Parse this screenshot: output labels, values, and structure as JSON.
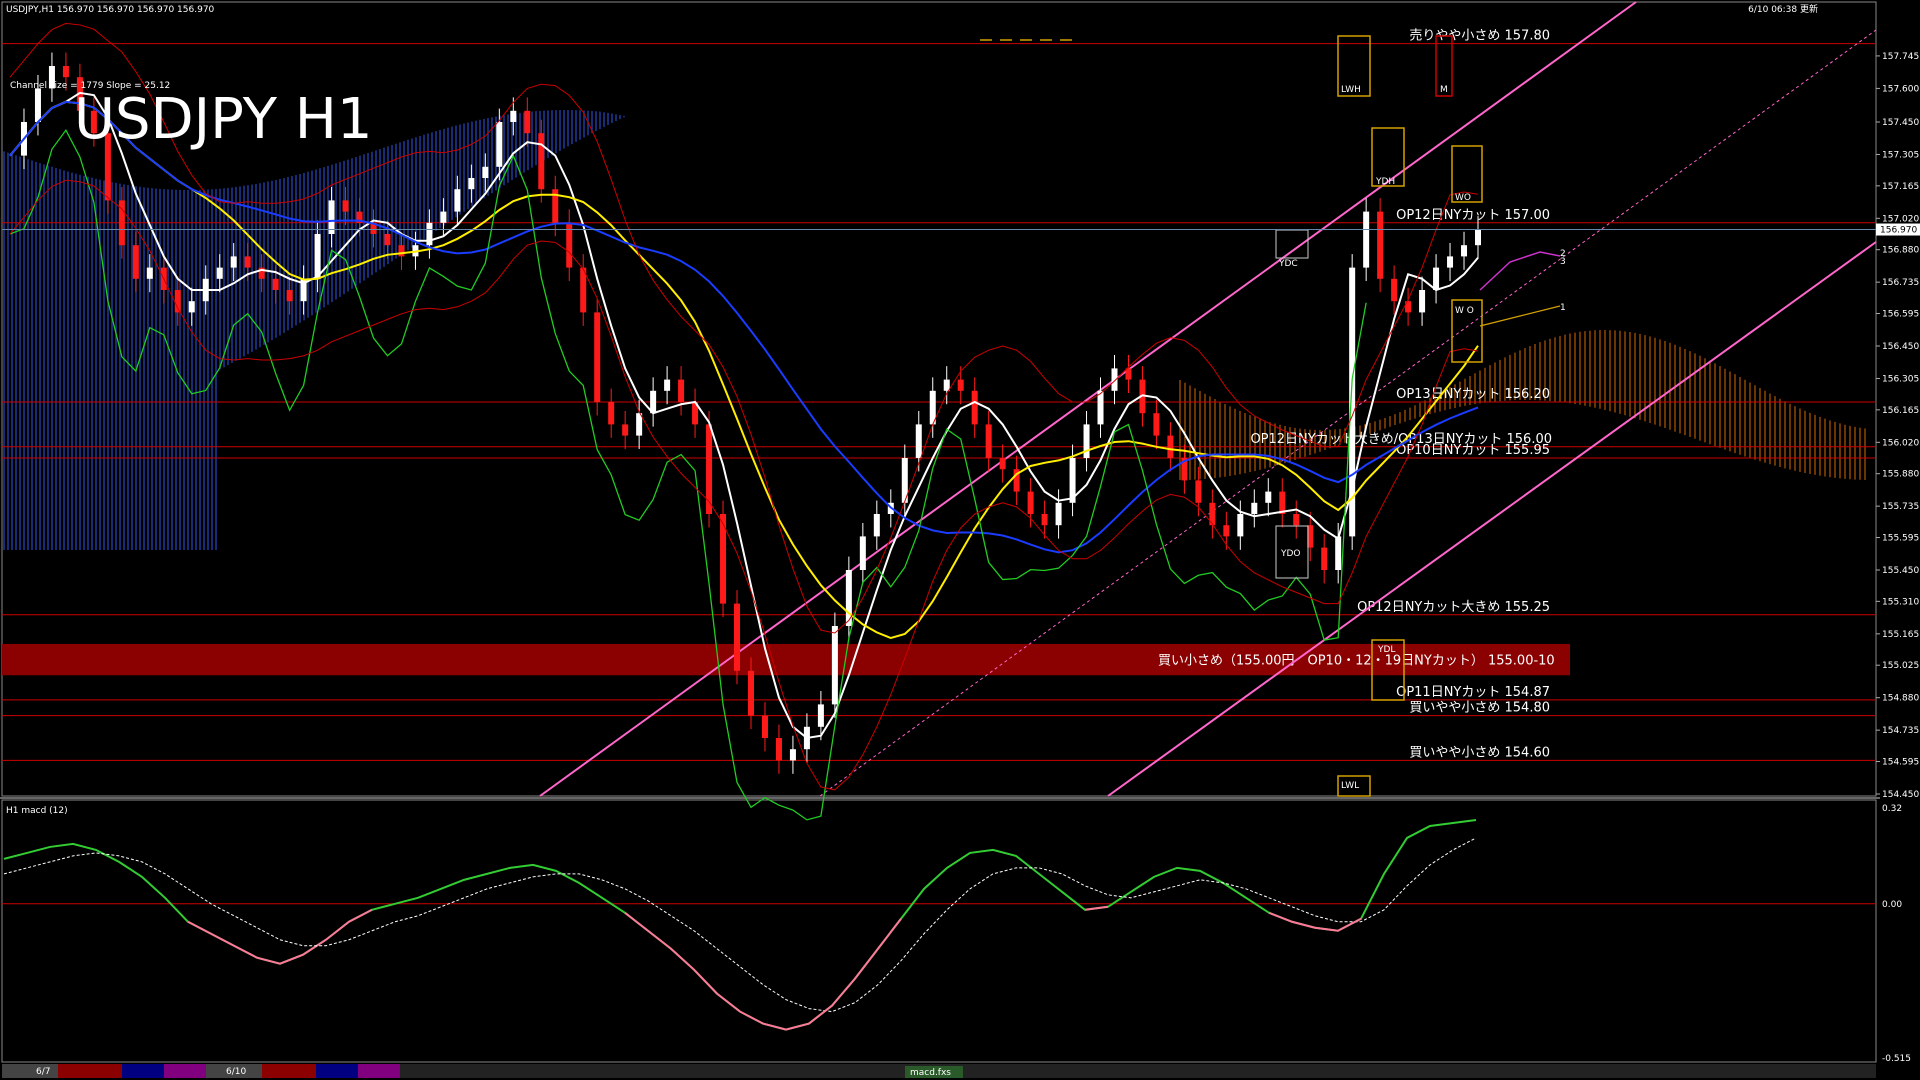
{
  "header": {
    "symbol_line": "USDJPY,H1  156.970 156.970 156.970 156.970",
    "datetime": "6/10 06:38 更新",
    "big_title": "USDJPY H1",
    "channel_info": "Channel size = 1779 Slope = 25.12"
  },
  "macd_panel": {
    "title": "H1  macd (12)"
  },
  "bottom_bar": {
    "label_1": "6/7",
    "label_2": "6/10",
    "label_3": "macd.fxs"
  },
  "colors": {
    "sell": "#cc0000",
    "buy": "#ffffff",
    "level_line": "#cc0000",
    "band": "#8b0000",
    "channel": "#ff66cc",
    "macd_main": "#33cc33",
    "macd_neg": "#ff7799",
    "signal": "#ffffff"
  },
  "chart_data": {
    "type": "line",
    "title": "USDJPY H1",
    "ylim": [
      154.45,
      157.95
    ],
    "price_ticks": [
      "157.745",
      "157.600",
      "157.450",
      "157.305",
      "157.165",
      "157.020",
      "156.880",
      "156.735",
      "156.595",
      "156.450",
      "156.305",
      "156.165",
      "156.020",
      "155.880",
      "155.735",
      "155.595",
      "155.450",
      "155.310",
      "155.165",
      "155.025",
      "154.880",
      "154.735",
      "154.595",
      "154.450"
    ],
    "current_price": "156.970",
    "levels": [
      {
        "price": 157.8,
        "text": "売りやや小さめ 157.80"
      },
      {
        "price": 157.0,
        "text": "OP12日NYカット 157.00"
      },
      {
        "price": 156.2,
        "text": "OP13日NYカット 156.20"
      },
      {
        "price": 156.0,
        "text": "OP12日NYカット大きめ/OP13日NYカット 156.00"
      },
      {
        "price": 155.95,
        "text": "OP10日NYカット 155.95"
      },
      {
        "price": 155.25,
        "text": "OP12日NYカット大きめ 155.25"
      },
      {
        "price": 154.87,
        "text": "OP11日NYカット 154.87"
      },
      {
        "price": 154.8,
        "text": "買いやや小さめ 154.80"
      },
      {
        "price": 154.6,
        "text": "買いやや小さめ 154.60"
      }
    ],
    "buy_band": {
      "price_top": 155.12,
      "price_bottom": 154.98,
      "text": "買い小さめ（155.00円　OP10・12・19日NYカット） 155.00-10"
    },
    "box_labels": [
      "LWH",
      "YDH",
      "YDC",
      "YDO",
      "YDL",
      "LWL",
      "M",
      "W O",
      "WO"
    ],
    "projection_labels": [
      "1",
      "2",
      "3"
    ],
    "close": [
      157.3,
      157.45,
      157.6,
      157.7,
      157.65,
      157.5,
      157.4,
      157.1,
      156.9,
      156.75,
      156.8,
      156.7,
      156.6,
      156.65,
      156.75,
      156.8,
      156.85,
      156.8,
      156.75,
      156.7,
      156.65,
      156.75,
      156.95,
      157.1,
      157.05,
      157.0,
      156.95,
      156.9,
      156.85,
      156.9,
      157.0,
      157.05,
      157.15,
      157.2,
      157.25,
      157.45,
      157.5,
      157.4,
      157.15,
      157.0,
      156.8,
      156.6,
      156.2,
      156.1,
      156.05,
      156.15,
      156.25,
      156.3,
      156.2,
      156.1,
      155.7,
      155.3,
      155.0,
      154.8,
      154.7,
      154.6,
      154.65,
      154.75,
      154.85,
      155.2,
      155.45,
      155.6,
      155.7,
      155.75,
      155.95,
      156.1,
      156.25,
      156.3,
      156.25,
      156.1,
      155.95,
      155.9,
      155.8,
      155.7,
      155.65,
      155.75,
      155.95,
      156.1,
      156.25,
      156.35,
      156.3,
      156.15,
      156.05,
      155.95,
      155.85,
      155.75,
      155.65,
      155.6,
      155.7,
      155.75,
      155.8,
      155.7,
      155.65,
      155.55,
      155.45,
      155.6,
      156.8,
      157.05,
      156.75,
      156.65,
      156.6,
      156.7,
      156.8,
      156.85,
      156.9,
      156.97
    ],
    "macd": [
      0.15,
      0.17,
      0.19,
      0.2,
      0.18,
      0.14,
      0.09,
      0.02,
      -0.06,
      -0.1,
      -0.14,
      -0.18,
      -0.2,
      -0.17,
      -0.12,
      -0.06,
      -0.02,
      0.0,
      0.02,
      0.05,
      0.08,
      0.1,
      0.12,
      0.13,
      0.11,
      0.07,
      0.02,
      -0.03,
      -0.09,
      -0.15,
      -0.22,
      -0.3,
      -0.36,
      -0.4,
      -0.42,
      -0.4,
      -0.34,
      -0.25,
      -0.15,
      -0.05,
      0.05,
      0.12,
      0.17,
      0.18,
      0.16,
      0.1,
      0.04,
      -0.02,
      -0.01,
      0.04,
      0.09,
      0.12,
      0.11,
      0.07,
      0.02,
      -0.03,
      -0.06,
      -0.08,
      -0.09,
      -0.05,
      0.1,
      0.22,
      0.26,
      0.27,
      0.28
    ],
    "macd_signal": [
      0.1,
      0.12,
      0.14,
      0.16,
      0.17,
      0.16,
      0.14,
      0.1,
      0.05,
      0.0,
      -0.04,
      -0.08,
      -0.12,
      -0.14,
      -0.14,
      -0.12,
      -0.09,
      -0.06,
      -0.04,
      -0.01,
      0.02,
      0.05,
      0.07,
      0.09,
      0.1,
      0.1,
      0.08,
      0.05,
      0.01,
      -0.04,
      -0.09,
      -0.15,
      -0.21,
      -0.27,
      -0.32,
      -0.35,
      -0.36,
      -0.33,
      -0.27,
      -0.19,
      -0.1,
      -0.02,
      0.05,
      0.1,
      0.12,
      0.12,
      0.1,
      0.06,
      0.03,
      0.02,
      0.04,
      0.06,
      0.08,
      0.07,
      0.05,
      0.02,
      -0.01,
      -0.04,
      -0.06,
      -0.06,
      -0.02,
      0.06,
      0.13,
      0.18,
      0.22
    ],
    "macd_ticks": [
      "0.32",
      "0.00",
      "-0.515"
    ],
    "macd_ylim": [
      -0.515,
      0.32
    ]
  }
}
